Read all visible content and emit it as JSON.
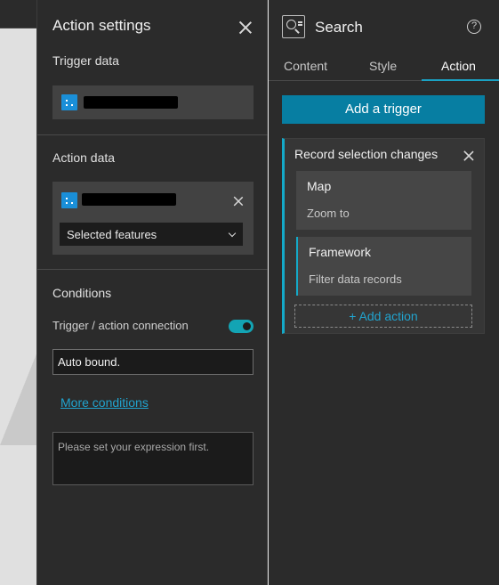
{
  "settings": {
    "title": "Action settings",
    "trigger_data_title": "Trigger data",
    "action_data_title": "Action data",
    "selected_value": "Selected features",
    "conditions_title": "Conditions",
    "connection_label": "Trigger / action connection",
    "connection_enabled": true,
    "auto_bound_value": "Auto bound.",
    "more_conditions_label": "More conditions",
    "expression_placeholder": "Please set your expression first."
  },
  "widget": {
    "title": "Search",
    "help_icon": "?",
    "tabs": [
      {
        "label": "Content",
        "active": false
      },
      {
        "label": "Style",
        "active": false
      },
      {
        "label": "Action",
        "active": true
      }
    ],
    "add_trigger_label": "Add a trigger",
    "trigger": {
      "title": "Record selection changes",
      "actions": [
        {
          "name": "Map",
          "description": "Zoom to"
        },
        {
          "name": "Framework",
          "description": "Filter data records"
        }
      ],
      "add_action_label": "+ Add action"
    }
  },
  "colors": {
    "accent": "#14a9c8",
    "primary_button": "#077ea2",
    "link": "#21a4cf",
    "panel_bg": "#2b2b2b"
  }
}
